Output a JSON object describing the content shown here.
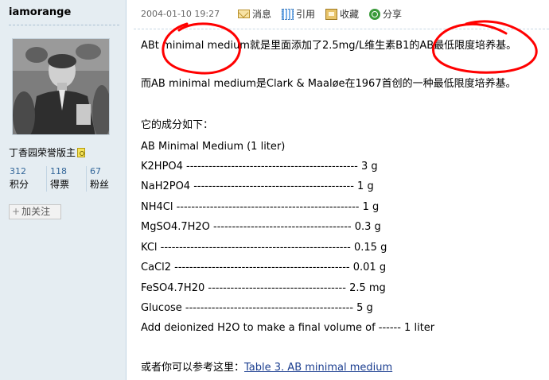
{
  "user": {
    "name": "iamorange",
    "title": "丁香园荣誉版主",
    "stats": [
      {
        "value": "312",
        "label": "积分"
      },
      {
        "value": "118",
        "label": "得票"
      },
      {
        "value": "67",
        "label": "粉丝"
      }
    ],
    "follow_label": "加关注"
  },
  "post": {
    "timestamp": "2004-01-10 19:27",
    "actions": [
      {
        "icon": "message-icon",
        "label": "消息"
      },
      {
        "icon": "quote-icon",
        "label": "引用"
      },
      {
        "icon": "favorite-icon",
        "label": "收藏"
      },
      {
        "icon": "share-icon",
        "label": "分享"
      }
    ],
    "body": {
      "p1": "ABt minimal medium就是里面添加了2.5mg/L维生素B1的AB最低限度培养基。",
      "p2": "而AB minimal medium是Clark & Maaløe在1967首创的一种最低限度培养基。",
      "components_heading": "它的成分如下：",
      "recipe_title": "AB Minimal Medium (1 liter)",
      "ingredients": [
        "K2HPO4 ---------------------------------------------- 3 g",
        "NaH2PO4 ------------------------------------------- 1 g",
        "NH4Cl ------------------------------------------------- 1 g",
        "MgSO4.7H2O ------------------------------------- 0.3 g",
        "KCl --------------------------------------------------- 0.15 g",
        "CaCl2 ----------------------------------------------- 0.01 g",
        "FeSO4.7H20 ------------------------------------- 2.5 mg",
        "Glucose --------------------------------------------- 5 g",
        "Add deionized H2O to make a final volume of ------ 1 liter"
      ],
      "reference_prefix": "或者你可以参考这里：",
      "reference_link": "Table 3. AB minimal medium"
    }
  },
  "colors": {
    "sidebar_bg": "#e5edf2",
    "link": "#1a3d8f",
    "annotation": "#ff0000"
  }
}
